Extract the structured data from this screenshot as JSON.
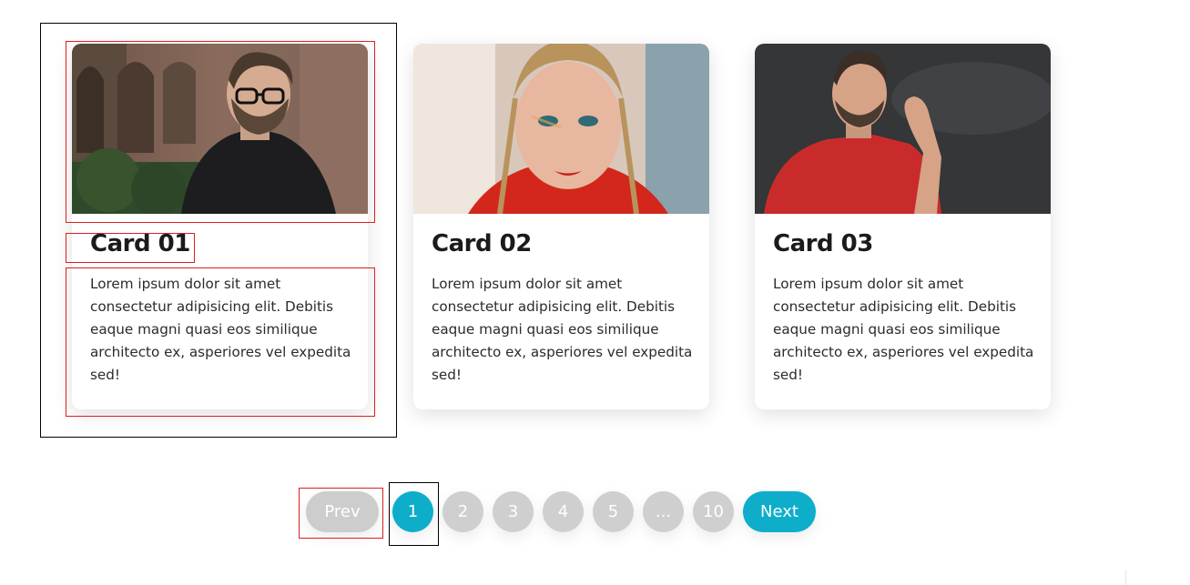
{
  "cards": [
    {
      "title": "Card 01",
      "text": "Lorem ipsum dolor sit amet consectetur adipisicing elit. Debitis eaque magni quasi eos similique architecto ex, asperiores vel expedita sed!",
      "image": "man-with-glasses-photo"
    },
    {
      "title": "Card 02",
      "text": "Lorem ipsum dolor sit amet consectetur adipisicing elit. Debitis eaque magni quasi eos similique architecto ex, asperiores vel expedita sed!",
      "image": "woman-red-shirt-photo"
    },
    {
      "title": "Card 03",
      "text": "Lorem ipsum dolor sit amet consectetur adipisicing elit. Debitis eaque magni quasi eos similique architecto ex, asperiores vel expedita sed!",
      "image": "man-listening-photo"
    }
  ],
  "pagination": {
    "prev_label": "Prev",
    "next_label": "Next",
    "pages": [
      "1",
      "2",
      "3",
      "4",
      "5",
      "...",
      "10"
    ],
    "active_page": "1"
  },
  "colors": {
    "accent": "#0eaecb",
    "inactive": "#cfcfcf",
    "title": "#1b1b1b",
    "text": "#2b2b2b"
  }
}
